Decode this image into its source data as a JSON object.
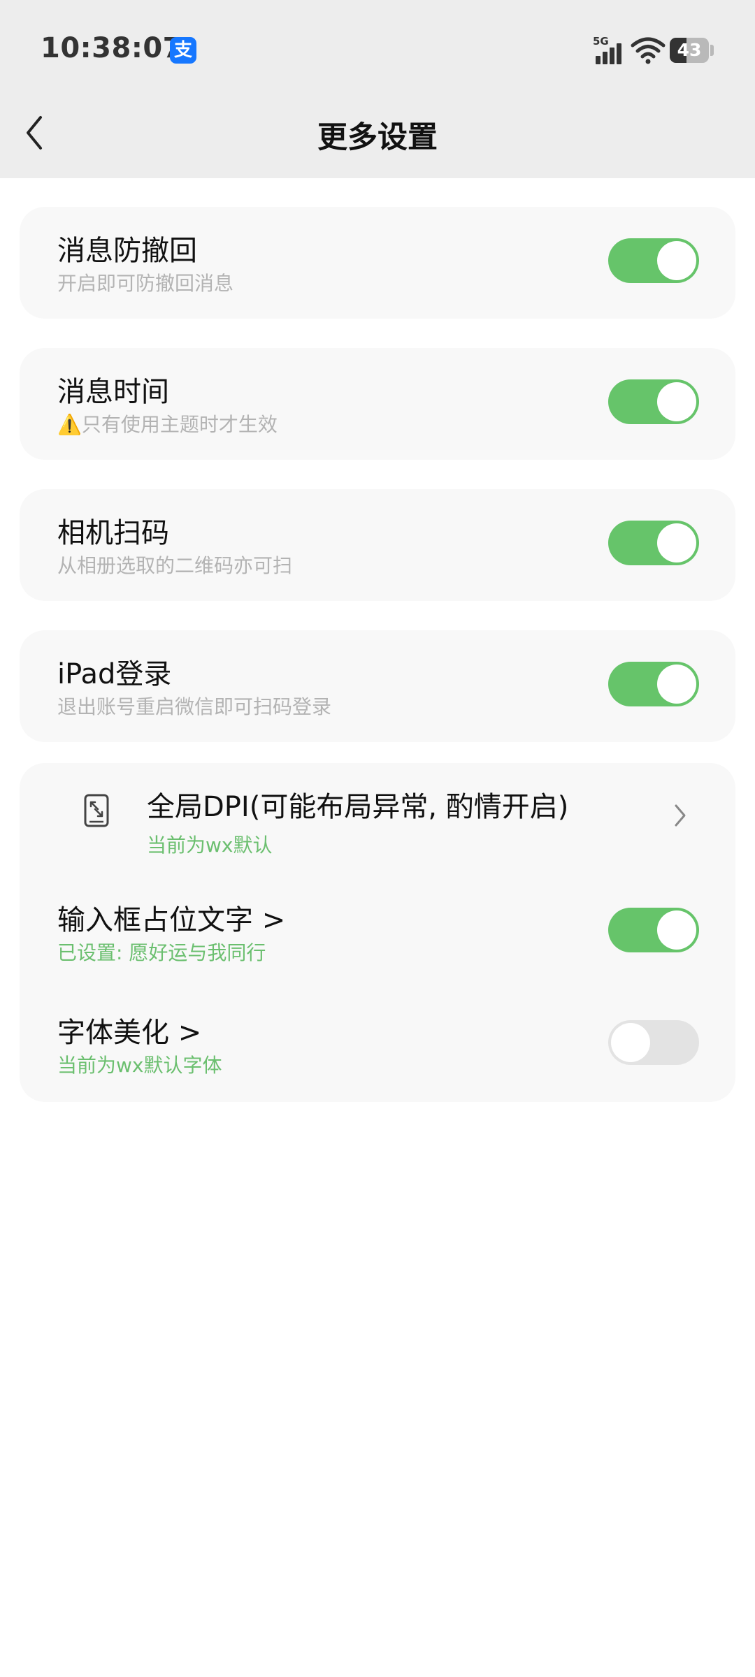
{
  "status_bar": {
    "time": "10:38:07",
    "app_badge": "支",
    "network": "5G",
    "battery": "43"
  },
  "header": {
    "title": "更多设置"
  },
  "settings": [
    {
      "title": "消息防撤回",
      "subtitle": "开启即可防撤回消息",
      "toggle": "on"
    },
    {
      "title": "消息时间",
      "subtitle": "⚠️只有使用主题时才生效",
      "toggle": "on"
    },
    {
      "title": "相机扫码",
      "subtitle": "从相册选取的二维码亦可扫",
      "toggle": "on"
    },
    {
      "title": "iPad登录",
      "subtitle": "退出账号重启微信即可扫码登录",
      "toggle": "on"
    }
  ],
  "group": {
    "dpi": {
      "title": "全局DPI(可能布局异常, 酌情开启)",
      "subtitle": "当前为wx默认"
    },
    "placeholder": {
      "title": "输入框占位文字 >",
      "subtitle": "已设置: 愿好运与我同行",
      "toggle": "on"
    },
    "font": {
      "title": "字体美化 >",
      "subtitle": "当前为wx默认字体",
      "toggle": "off"
    }
  },
  "colors": {
    "accent_green": "#66c46a",
    "header_bg": "#ededed",
    "card_bg": "#f8f8f8"
  }
}
